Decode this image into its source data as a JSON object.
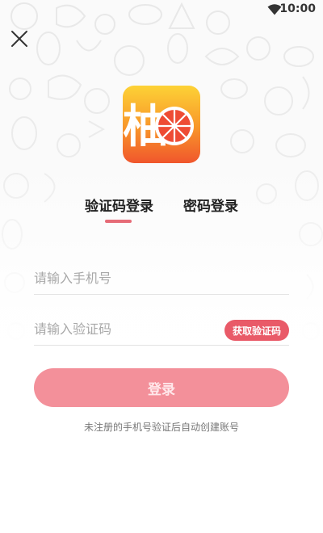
{
  "status_bar": {
    "time": "10:00",
    "icons": [
      "wifi-icon"
    ]
  },
  "header": {
    "close_icon": "close-icon"
  },
  "app_logo": {
    "character": "柚",
    "icon": "grapefruit-slice-icon"
  },
  "tabs": [
    {
      "label": "验证码登录",
      "active": true
    },
    {
      "label": "密码登录",
      "active": false
    }
  ],
  "form": {
    "phone": {
      "placeholder": "请输入手机号",
      "value": ""
    },
    "code": {
      "placeholder": "请输入验证码",
      "value": ""
    },
    "get_code_label": "获取验证码"
  },
  "login_button": {
    "label": "登录"
  },
  "hint": "未注册的手机号验证后自动创建账号",
  "colors": {
    "accent": "#e95a68",
    "tab_indicator": "#e66b77",
    "login_button": "#f3909a",
    "logo_gradient_top": "#fdd236",
    "logo_gradient_bottom": "#f0562c"
  }
}
